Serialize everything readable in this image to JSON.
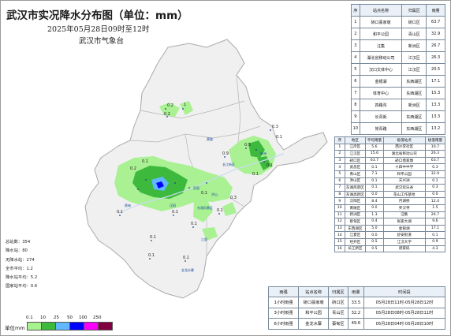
{
  "title": "武汉市实况降水分布图（单位：mm）",
  "subtitle": "2025年05月28日09时至12时",
  "org": "武汉市气象台",
  "colors": {
    "land": "#f0f0f0",
    "boundary": "#a9a9a9",
    "level1": "#a6f28f",
    "level2": "#3dba3d",
    "level3": "#61b8ff",
    "level4": "#0000fe",
    "level5": "#fa00fa",
    "level6": "#800040"
  },
  "stats": {
    "total_stations": "总站数：354",
    "rain_stations": "降水站：80",
    "no_rain_stations": "无降水站：274",
    "avg_all": "全市平均：1.2",
    "avg_rain": "降水站平均：5.2",
    "avg_national": "国家站平均：0.6"
  },
  "legend": {
    "label": "单位mm",
    "ticks": [
      "0.1",
      "10",
      "25",
      "50",
      "100",
      "250"
    ]
  },
  "station_table": {
    "headers": [
      "序",
      "站点名称",
      "归属区",
      "雨量"
    ],
    "rows": [
      [
        "1",
        "硚口翡家墩",
        "硚口区",
        "63.7"
      ],
      [
        "2",
        "和平公园",
        "青山区",
        "32.9"
      ],
      [
        "3",
        "汪集",
        "新洲区",
        "26.7"
      ],
      [
        "4",
        "湖北省移动公司",
        "江汉区",
        "26.3"
      ],
      [
        "5",
        "汉口文体中心",
        "江汉区",
        "20.5"
      ],
      [
        "6",
        "金银湖",
        "东西湖区",
        "17.1"
      ],
      [
        "7",
        "体育中心",
        "东西湖区",
        "15.3"
      ],
      [
        "8",
        "四路沟",
        "新洲区",
        "13.3"
      ],
      [
        "9",
        "长青街",
        "东西湖区",
        "13.3"
      ],
      [
        "10",
        "常青路",
        "东西湖区",
        "13.2"
      ]
    ]
  },
  "district_table": {
    "headers": [
      "序",
      "地区",
      "平均雨量",
      "极值站点",
      "极值雨量"
    ],
    "rows": [
      [
        "1",
        "江岸区",
        "5.6",
        "西沙李社区",
        "10.7"
      ],
      [
        "2",
        "江汉区",
        "15.6",
        "湖北省移动公司",
        "26.3"
      ],
      [
        "3",
        "硚口区",
        "63.7",
        "硚口翡家墩",
        "63.7"
      ],
      [
        "4",
        "武昌区",
        "0.1",
        "十四中中学",
        "0.3"
      ],
      [
        "5",
        "青山区",
        "7.1",
        "和平公园",
        "32.9"
      ],
      [
        "6",
        "洪山区",
        "0.1",
        "天兴洲",
        "0.1"
      ],
      [
        "7",
        "东湖风景区",
        "0.1",
        "武汉欢乐谷",
        "0.3"
      ],
      [
        "8",
        "东湖高新区",
        "0.0",
        "花山工作基地",
        "0.0"
      ],
      [
        "9",
        "汉阳区",
        "8.4",
        "月湖桥",
        "12.4"
      ],
      [
        "10",
        "黄陂区",
        "0.0",
        "罗汉寺",
        "1.5"
      ],
      [
        "11",
        "新洲区",
        "1.3",
        "汪集",
        "26.7"
      ],
      [
        "12",
        "蔡甸区",
        "0.4",
        "张家大湖",
        "9.6"
      ],
      [
        "13",
        "东西湖区",
        "5.0",
        "金银湖",
        "17.1"
      ],
      [
        "14",
        "江夏区",
        "0.0",
        "舒安街道",
        "0.1"
      ],
      [
        "15",
        "经开区",
        "0.5",
        "江汉大学",
        "0.9"
      ],
      [
        "16",
        "长江新区",
        "0.5",
        "谌家矶",
        "4.3"
      ]
    ]
  },
  "max_table": {
    "headers": [
      "雨强",
      "站点名称",
      "归属区",
      "雨量",
      "时间段"
    ],
    "rows": [
      [
        "1小时雨强",
        "硚口翡家墩",
        "硚口区",
        "33.5",
        "05月28日11时-05月28日12时"
      ],
      [
        "3小时雨强",
        "和平公园",
        "青山区",
        "32.2",
        "05月28日08时-05月28日11时"
      ],
      [
        "6小时雨强",
        "金龙水寨",
        "蔡甸区",
        "49.6",
        "05月28日04时-05月28日10时"
      ]
    ]
  },
  "map_labels": {
    "values": [
      "0.2",
      "1",
      "0.2",
      "0.3",
      "0.3",
      "0.1",
      "0.9",
      "0.1",
      "0.1",
      "0.1",
      "0.1",
      "0.1",
      "0.1",
      "0.3",
      "0.2",
      "0.1",
      "0.1",
      "0.1",
      "0.1",
      "0.1"
    ],
    "districts": [
      "金龙水寨",
      "东湖风景区",
      "武昌",
      "洪山",
      "新洲",
      "黄陂",
      "汉阳",
      "江夏",
      "蔡甸",
      "长江新区"
    ]
  }
}
